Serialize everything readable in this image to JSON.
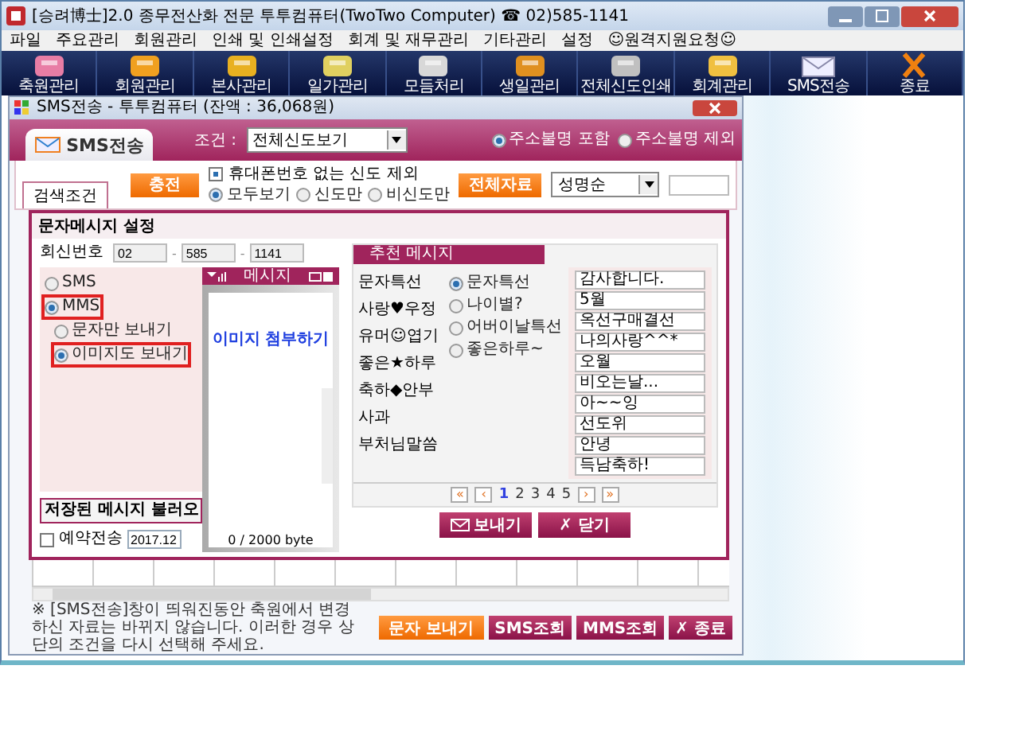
{
  "window": {
    "title": "[승려博士]2.0 종무전산화 전문 투투컴퓨터(TwoTwo Computer) ☎ 02)585-1141"
  },
  "menu": [
    "파일",
    "주요관리",
    "회원관리",
    "인쇄 및 인쇄설정",
    "회계 및 재무관리",
    "기타관리",
    "설정",
    "☺원격지원요청☺"
  ],
  "toolbar": [
    {
      "label": "축원관리"
    },
    {
      "label": "회원관리"
    },
    {
      "label": "본사관리"
    },
    {
      "label": "일가관리"
    },
    {
      "label": "모듬처리"
    },
    {
      "label": "생일관리"
    },
    {
      "label": "전체신도인쇄"
    },
    {
      "label": "회계관리"
    },
    {
      "label": "SMS전송"
    },
    {
      "label": "종료"
    }
  ],
  "dialog": {
    "title": "SMS전송 - 투투컴퓨터 (잔액 : 36,068원)",
    "tab": "SMS전송",
    "condition_label": "조건 :",
    "condition_value": "전체신도보기",
    "address_options": [
      {
        "label": "주소불명 포함",
        "selected": true
      },
      {
        "label": "주소불명 제외",
        "selected": false
      }
    ],
    "search_tab": "검색조건",
    "charge_button": "충전",
    "exclude_no_phone": {
      "label": "휴대폰번호 없는 신도 제외",
      "checked": true
    },
    "filter_options": [
      {
        "label": "모두보기",
        "selected": true
      },
      {
        "label": "신도만",
        "selected": false
      },
      {
        "label": "비신도만",
        "selected": false
      }
    ],
    "all_data_button": "전체자료",
    "sort_value": "성명순",
    "message_panel": {
      "title": "문자메시지 설정",
      "reply_label": "회신번호",
      "reply_number": [
        "02",
        "585",
        "1141"
      ],
      "reply_separator": "-",
      "types": [
        {
          "label": "SMS",
          "selected": false,
          "highlighted": false
        },
        {
          "label": "MMS",
          "selected": true,
          "highlighted": true
        }
      ],
      "mms_options": [
        {
          "label": "문자만 보내기",
          "selected": false,
          "highlighted": false
        },
        {
          "label": "이미지도 보내기",
          "selected": true,
          "highlighted": true
        }
      ],
      "load_button": "저장된 메시지 불러오",
      "reserve": {
        "label": "예약전송",
        "checked": false,
        "date": "2017.12"
      },
      "phone": {
        "header": "메시지",
        "attach_link": "이미지 첨부하기",
        "counter": "0 / 2000 byte"
      },
      "recommend": {
        "title": "추천 메시지",
        "categories": [
          "문자특선",
          "사랑♥우정",
          "유머☺엽기",
          "좋은★하루",
          "축하◆안부",
          "사과",
          "부처님말씀"
        ],
        "themes": [
          {
            "label": "문자특선",
            "selected": true
          },
          {
            "label": "나이별?",
            "selected": false
          },
          {
            "label": "어버이날특선",
            "selected": false
          },
          {
            "label": "좋은하루~",
            "selected": false
          }
        ],
        "messages": [
          "감사합니다.",
          "5월",
          "옥선구매결선",
          "나의사랑^^*",
          "오월",
          "비오는날...",
          "아~~잉",
          "선도위",
          "안녕",
          "득남축하!"
        ],
        "pager": {
          "prev": [
            "«",
            "‹"
          ],
          "pages": [
            {
              "label": "1",
              "selected": true
            },
            {
              "label": "2",
              "selected": false
            },
            {
              "label": "3",
              "selected": false
            },
            {
              "label": "4",
              "selected": false
            },
            {
              "label": "5",
              "selected": false
            }
          ],
          "next": [
            "›",
            "»"
          ]
        }
      },
      "send_button": "보내기",
      "close_button": "✗ 닫기"
    },
    "footer": {
      "note": "※ [SMS전송]창이 띄워진동안 축원에서 변경하신 자료는 바뀌지 않습니다. 이러한 경우 상단의 조건을 다시 선택해 주세요.",
      "buttons": [
        {
          "label": "문자 보내기",
          "kind": "primary"
        },
        {
          "label": "SMS조회",
          "kind": "secondary"
        },
        {
          "label": "MMS조회",
          "kind": "secondary"
        },
        {
          "label": "✗ 종료",
          "kind": "secondary"
        }
      ]
    }
  }
}
